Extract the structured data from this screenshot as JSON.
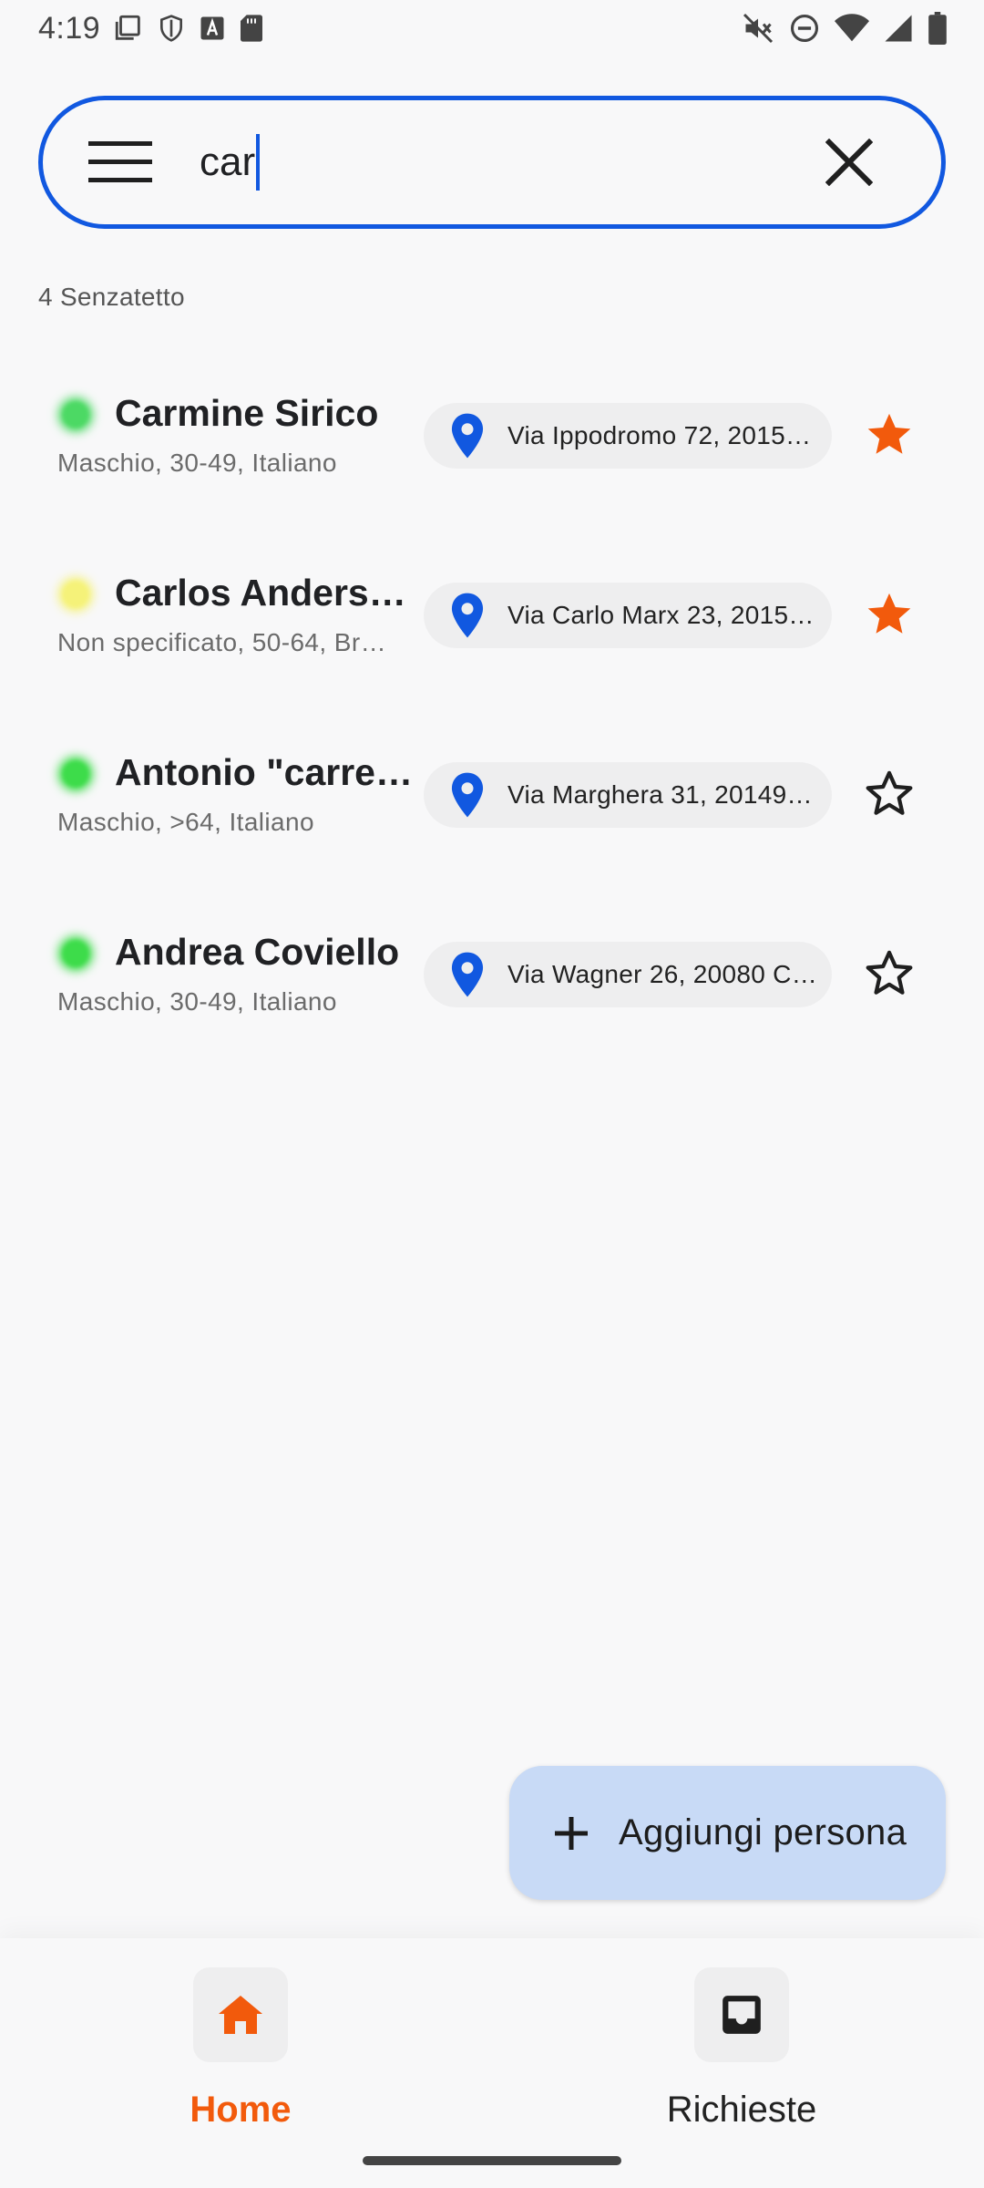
{
  "status_bar": {
    "time": "4:19",
    "left_icons": [
      "screenshot-icon",
      "shield-icon",
      "font-icon",
      "sd-card-icon"
    ],
    "right_icons": [
      "mute-icon",
      "dnd-icon",
      "wifi-icon",
      "signal-icon",
      "battery-icon"
    ]
  },
  "search": {
    "value": "car",
    "menu_icon": "hamburger-menu-icon",
    "clear_icon": "close-icon",
    "accent_color": "#1158e0"
  },
  "results": {
    "count_label": "4 Senzatetto"
  },
  "people": [
    {
      "name": "Carmine Sirico",
      "info": "Maschio, 30-49,  Italiano",
      "address": "Via Ippodromo 72, 2015…",
      "status_color": "#4cd964",
      "favorite": true
    },
    {
      "name": "Carlos Anderso…",
      "info": "Non specificato, 50-64,  Br…",
      "address": "Via Carlo Marx 23, 2015…",
      "status_color": "#f5f279",
      "favorite": true
    },
    {
      "name": "Antonio \"carrell…",
      "info": "Maschio, >64,  Italiano",
      "address": "Via Marghera 31, 20149…",
      "status_color": "#3ddc4a",
      "favorite": false
    },
    {
      "name": "Andrea Coviello",
      "info": "Maschio, 30-49,  Italiano",
      "address": "Via Wagner 26, 20080 C…",
      "status_color": "#3ddc4a",
      "favorite": false
    }
  ],
  "fab": {
    "label": "Aggiungi persona",
    "icon": "plus-icon",
    "color": "#c8daf6"
  },
  "nav": {
    "home_label": "Home",
    "requests_label": "Richieste",
    "active_color": "#f25a0c"
  },
  "colors": {
    "star_active": "#f25a0c",
    "pin": "#1158e0"
  }
}
